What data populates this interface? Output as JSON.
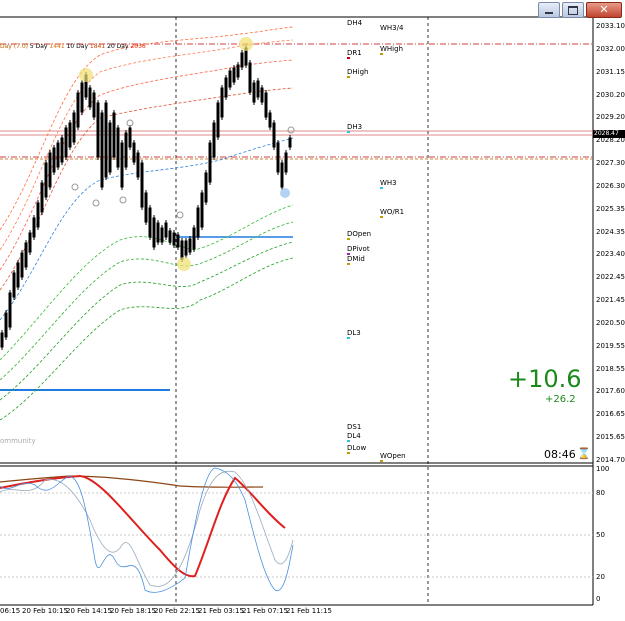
{
  "window": {
    "minimize_label": "minimize",
    "restore_label": "restore",
    "close_label": "close"
  },
  "top_legend": {
    "item1": "Day (7.0)",
    "item2": "5 Day",
    "item2_val": "1441",
    "item3": "10 Day",
    "item3_val": "1841",
    "item4": "20 Day",
    "item4_val": "2036"
  },
  "price_axis": [
    "2033.10",
    "2032.00",
    "2031.15",
    "2030.20",
    "2029.20",
    "2028.20",
    "2027.30",
    "2026.30",
    "2025.35",
    "2024.35",
    "2023.40",
    "2022.45",
    "2021.45",
    "2020.50",
    "2019.55",
    "2018.55",
    "2017.60",
    "2016.65",
    "2015.65",
    "2014.70"
  ],
  "current_price": "2028.47",
  "osc_axis": [
    "100",
    "80",
    "50",
    "20",
    "0"
  ],
  "time_axis": [
    "06:15",
    "20 Feb 10:15",
    "20 Feb 14:15",
    "20 Feb 18:15",
    "20 Feb 22:15",
    "21 Feb 03:15",
    "21 Feb 07:15",
    "21 Feb 11:15"
  ],
  "levels": {
    "dh4": "DH4",
    "wh34": "WH3/4",
    "dr1": "DR1",
    "whigh": "WHigh",
    "dhigh": "DHigh",
    "dh3": "DH3",
    "wh3": "WH3",
    "wor1": "WO/R1",
    "dopen": "DOpen",
    "dpivot": "DPivot",
    "dmid": "DMid",
    "dl3": "DL3",
    "ds1": "DS1",
    "dl4": "DL4",
    "dlow": "DLow",
    "wopen": "WOpen"
  },
  "pnl": {
    "main": "+10.6",
    "sub": "+26.2",
    "main_color": "#1a8a1a"
  },
  "clock": {
    "time": "08:46",
    "icon": "hourglass-icon"
  },
  "watermark": "ommunity"
}
